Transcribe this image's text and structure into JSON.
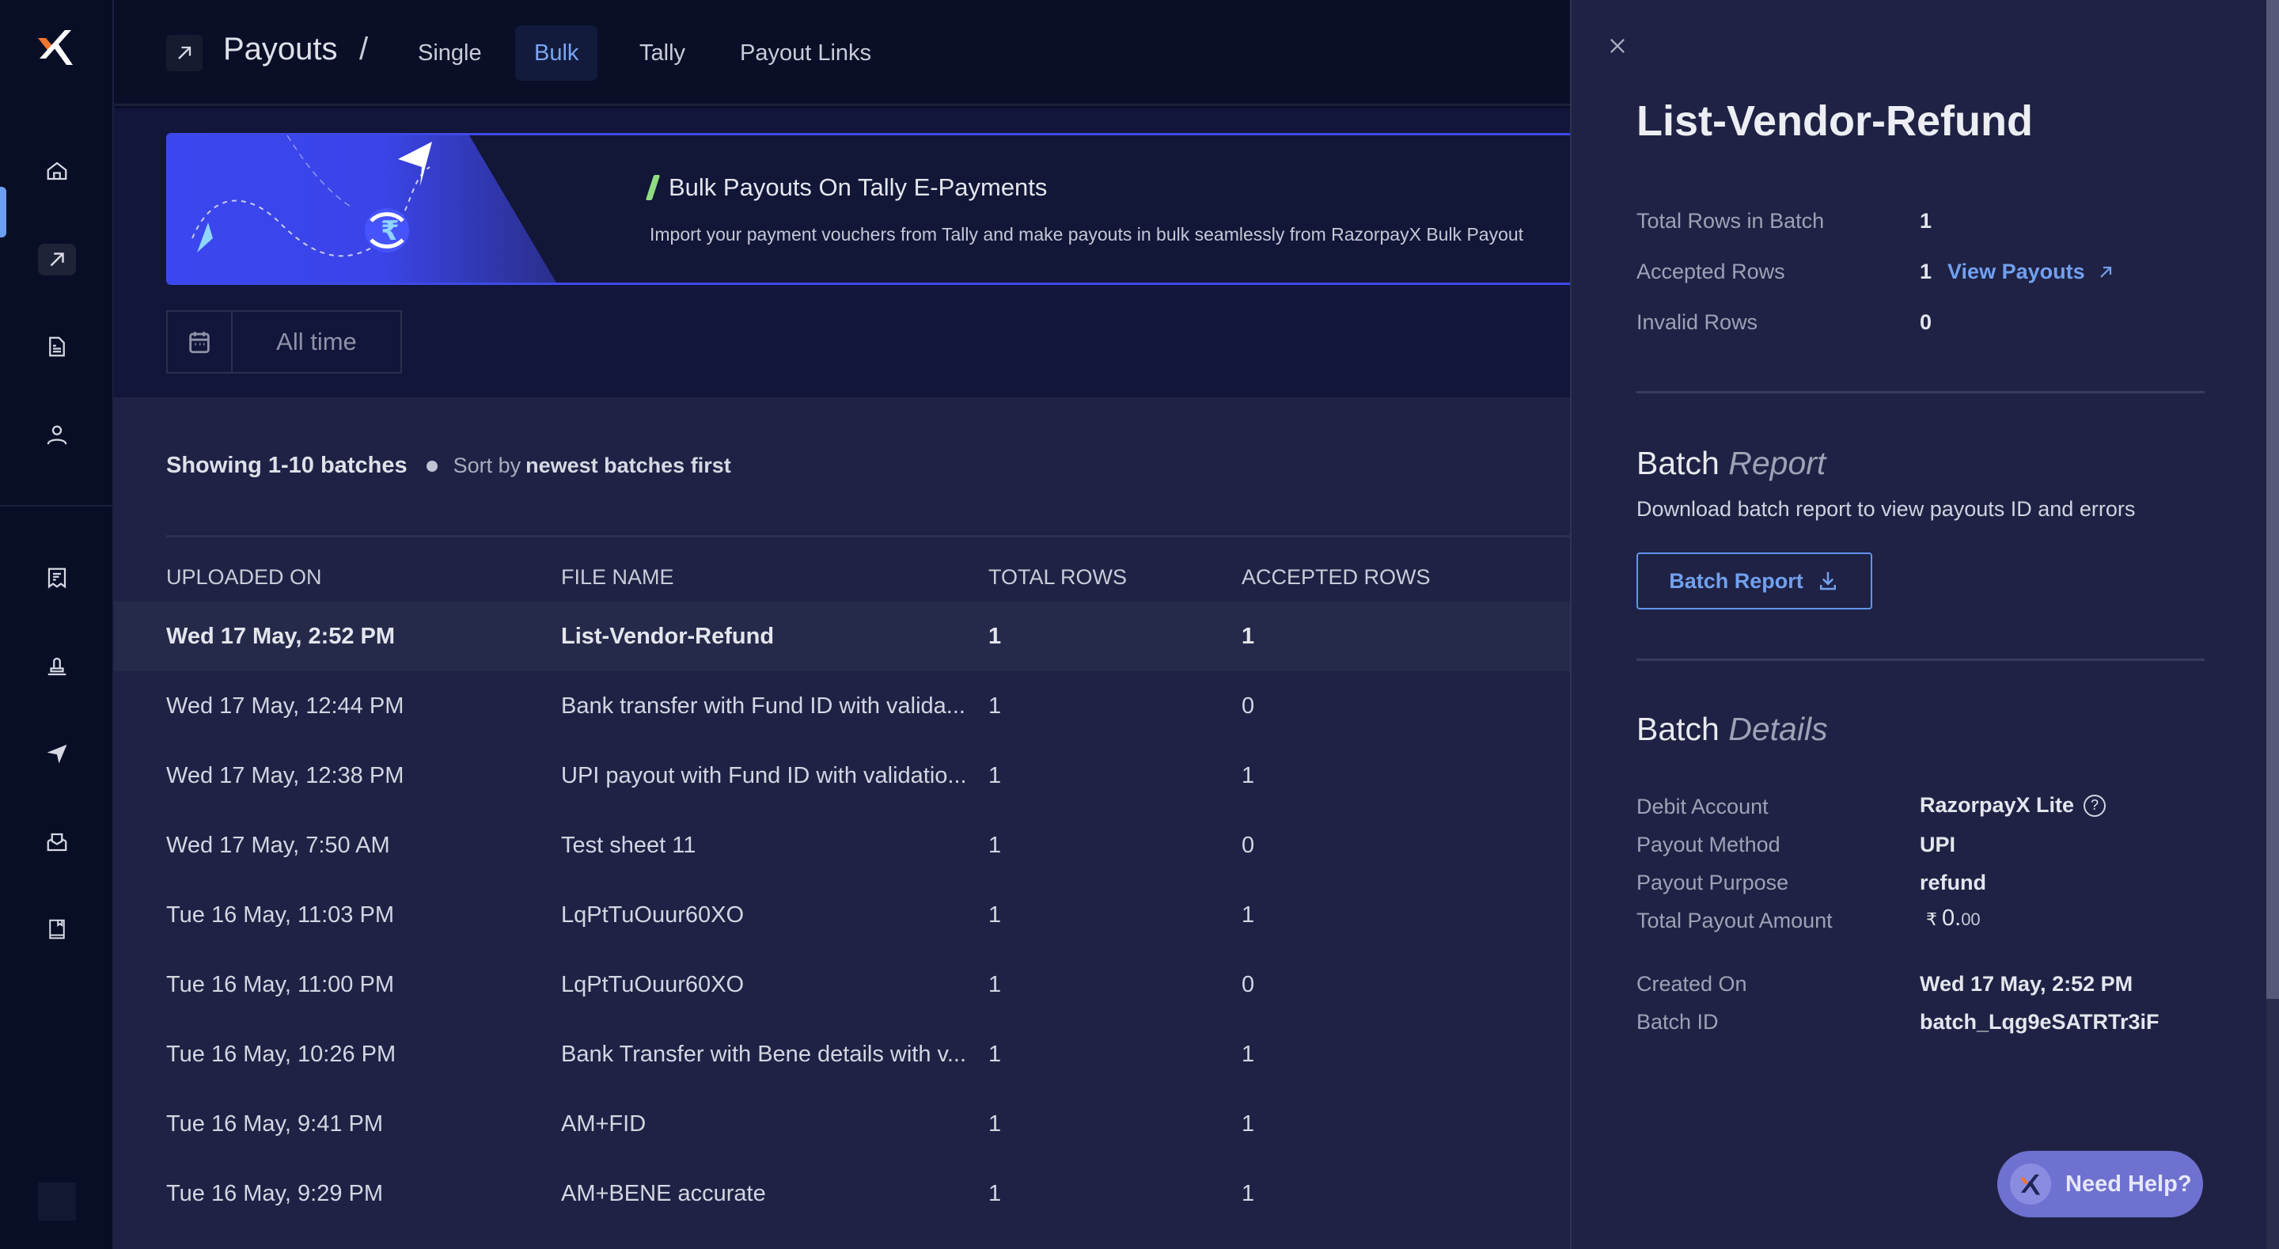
{
  "app": {
    "brand": "RazorpayX",
    "colors": {
      "accent": "#72a0ef",
      "banner_border": "#3f4ae6",
      "banner_accent": "#8fdc82",
      "help_button": "#6e71d0",
      "logo_orange": "#f0752e"
    }
  },
  "sidebar": {
    "items": [
      {
        "name": "home",
        "icon": "home-icon",
        "active": false
      },
      {
        "name": "payouts",
        "icon": "arrow-up-right-icon",
        "active": true
      },
      {
        "name": "invoices",
        "icon": "document-icon",
        "active": false
      },
      {
        "name": "contacts",
        "icon": "user-icon",
        "active": false
      },
      {
        "name": "tax-payments",
        "icon": "receipt-icon",
        "active": false
      },
      {
        "name": "vendor-payments",
        "icon": "stamp-icon",
        "active": false
      },
      {
        "name": "payout-links",
        "icon": "paper-plane-icon",
        "active": false
      },
      {
        "name": "inbox",
        "icon": "inbox-icon",
        "active": false
      },
      {
        "name": "reports",
        "icon": "book-icon",
        "active": false
      }
    ]
  },
  "header": {
    "icon": "arrow-up-right-icon",
    "title": "Payouts",
    "separator": "/",
    "tabs": [
      {
        "label": "Single",
        "active": false
      },
      {
        "label": "Bulk",
        "active": true
      },
      {
        "label": "Tally",
        "active": false
      },
      {
        "label": "Payout Links",
        "active": false
      }
    ]
  },
  "banner": {
    "title": "Bulk Payouts On Tally E-Payments",
    "description": "Import your payment vouchers from Tally and make payouts in bulk seamlessly from RazorpayX Bulk Payout"
  },
  "filter": {
    "date_icon": "calendar-icon",
    "date_value": "All time"
  },
  "listing": {
    "showing": "Showing 1-10 batches",
    "sort_prefix": "Sort by",
    "sort_value": "newest batches first"
  },
  "table": {
    "columns": [
      "UPLOADED ON",
      "FILE NAME",
      "TOTAL ROWS",
      "ACCEPTED ROWS"
    ],
    "rows": [
      {
        "uploaded_on": "Wed 17 May, 2:52 PM",
        "file_name": "List-Vendor-Refund",
        "total_rows": "1",
        "accepted_rows": "1",
        "selected": true
      },
      {
        "uploaded_on": "Wed 17 May, 12:44 PM",
        "file_name": "Bank transfer with Fund ID with valida...",
        "total_rows": "1",
        "accepted_rows": "0",
        "selected": false
      },
      {
        "uploaded_on": "Wed 17 May, 12:38 PM",
        "file_name": "UPI payout with Fund ID with validatio...",
        "total_rows": "1",
        "accepted_rows": "1",
        "selected": false
      },
      {
        "uploaded_on": "Wed 17 May, 7:50 AM",
        "file_name": "Test sheet 11",
        "total_rows": "1",
        "accepted_rows": "0",
        "selected": false
      },
      {
        "uploaded_on": "Tue 16 May, 11:03 PM",
        "file_name": "LqPtTuOuur60XO",
        "total_rows": "1",
        "accepted_rows": "1",
        "selected": false
      },
      {
        "uploaded_on": "Tue 16 May, 11:00 PM",
        "file_name": "LqPtTuOuur60XO",
        "total_rows": "1",
        "accepted_rows": "0",
        "selected": false
      },
      {
        "uploaded_on": "Tue 16 May, 10:26 PM",
        "file_name": "Bank Transfer with Bene details with v...",
        "total_rows": "1",
        "accepted_rows": "1",
        "selected": false
      },
      {
        "uploaded_on": "Tue 16 May, 9:41 PM",
        "file_name": "AM+FID",
        "total_rows": "1",
        "accepted_rows": "1",
        "selected": false
      },
      {
        "uploaded_on": "Tue 16 May, 9:29 PM",
        "file_name": "AM+BENE accurate",
        "total_rows": "1",
        "accepted_rows": "1",
        "selected": false
      }
    ]
  },
  "panel": {
    "title": "List-Vendor-Refund",
    "summary": [
      {
        "label": "Total Rows in Batch",
        "value": "1"
      },
      {
        "label": "Accepted Rows",
        "value": "1",
        "link": "View Payouts"
      },
      {
        "label": "Invalid Rows",
        "value": "0"
      }
    ],
    "report": {
      "title_main": "Batch",
      "title_em": "Report",
      "description": "Download batch report to view payouts ID and errors",
      "button_label": "Batch Report"
    },
    "details": {
      "title_main": "Batch",
      "title_em": "Details",
      "debit_account_label": "Debit Account",
      "debit_account_value": "RazorpayX Lite",
      "payout_method_label": "Payout Method",
      "payout_method_value": "UPI",
      "payout_purpose_label": "Payout Purpose",
      "payout_purpose_value": "refund",
      "total_amount_label": "Total Payout Amount",
      "total_amount_symbol": "₹",
      "total_amount_int": "0.",
      "total_amount_dec": "00",
      "created_on_label": "Created On",
      "created_on_value": "Wed 17 May, 2:52 PM",
      "batch_id_label": "Batch ID",
      "batch_id_value": "batch_Lqg9eSATRTr3iF"
    }
  },
  "help": {
    "label": "Need Help?"
  },
  "scroll": {
    "panel_scroll_visible_fraction": 0.8
  }
}
